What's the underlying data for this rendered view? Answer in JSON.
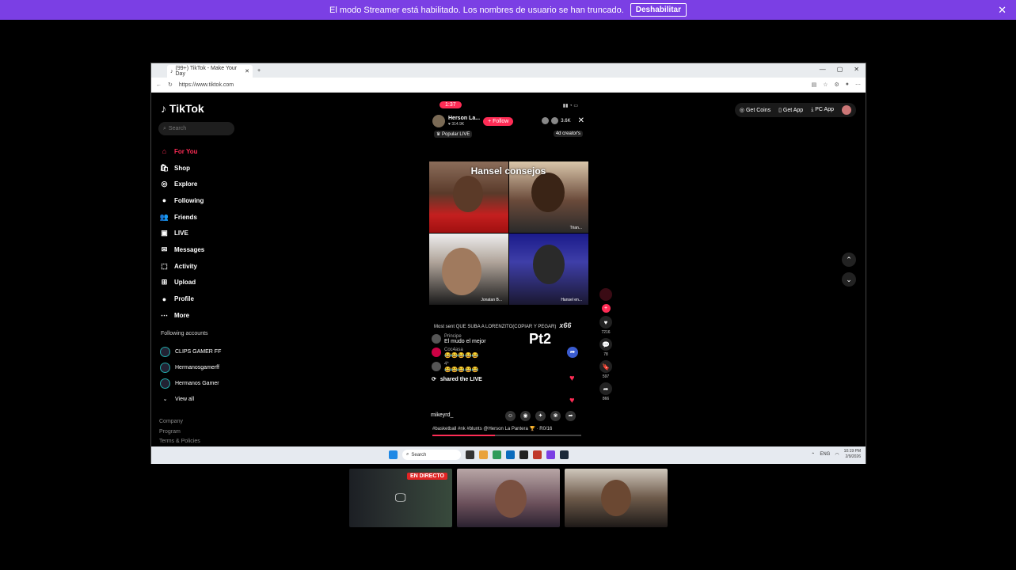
{
  "banner": {
    "text": "El modo Streamer está habilitado. Los nombres de usuario se han truncado.",
    "button": "Deshabilitar",
    "close": "✕"
  },
  "browser": {
    "tab_title": "(99+) TikTok - Make Your Day",
    "new_tab": "+",
    "url": "https://www.tiktok.com",
    "window_controls": [
      "—",
      "▢",
      "✕"
    ]
  },
  "tiktok": {
    "logo": "TikTok",
    "search_placeholder": "Search",
    "nav": [
      {
        "label": "For You",
        "icon": "home-icon",
        "glyph": "⌂"
      },
      {
        "label": "Shop",
        "icon": "shop-icon",
        "glyph": "🛍"
      },
      {
        "label": "Explore",
        "icon": "compass-icon",
        "glyph": "◎"
      },
      {
        "label": "Following",
        "icon": "avatar-icon",
        "glyph": "●"
      },
      {
        "label": "Friends",
        "icon": "friends-icon",
        "glyph": "👥"
      },
      {
        "label": "LIVE",
        "icon": "live-icon",
        "glyph": "▣"
      },
      {
        "label": "Messages",
        "icon": "messages-icon",
        "glyph": "✉"
      },
      {
        "label": "Activity",
        "icon": "activity-icon",
        "glyph": "⬚"
      },
      {
        "label": "Upload",
        "icon": "upload-icon",
        "glyph": "⊞"
      },
      {
        "label": "Profile",
        "icon": "profile-icon",
        "glyph": "●"
      },
      {
        "label": "More",
        "icon": "more-icon",
        "glyph": "⋯"
      }
    ],
    "following_header": "Following accounts",
    "following": [
      "CLIPS GAMER FF",
      "Hermanosgamerff",
      "Hermanos Gamer"
    ],
    "view_all": "View all",
    "footer": [
      "Company",
      "Program",
      "Terms & Policies"
    ],
    "top_right": {
      "coins": "Get Coins",
      "app": "Get App",
      "pc": "PC App"
    }
  },
  "live": {
    "time": "1:37",
    "host_name": "Herson La...",
    "host_likes": "314.9K",
    "follow": "+ Follow",
    "viewers": "3.6K",
    "popular": "Popular LIVE",
    "creators": "4d creator's",
    "grid_title": "Hansel consejos",
    "cell2_name": "Trian...",
    "cell3_name": "Jonatan B...",
    "cell4_name": "Hansel en...",
    "most_sent": "Most sent QUE SUBA A LORENZITO(COPIAR Y PEGAR)",
    "multiplier": "x66",
    "overlay": "Pt2",
    "chat": [
      {
        "user": "Principe",
        "text": "El mudo el mejor"
      },
      {
        "user": "Coc4asa",
        "text": "😂😂😂😂😂"
      },
      {
        "user": "4*",
        "text": "😂😂😂😂😂"
      }
    ],
    "shared": "shared the LIVE",
    "comment_user": "mikeyrd_",
    "hashtags": "#basketball #nk #blunts @Herson La Pantera 🏆 ·   R0/16",
    "progress": 0.42,
    "actions": [
      {
        "icon": "heart-icon",
        "glyph": "♥",
        "count": "7216"
      },
      {
        "icon": "comment-icon",
        "glyph": "💬",
        "count": "78"
      },
      {
        "icon": "bookmark-icon",
        "glyph": "🔖",
        "count": "597"
      },
      {
        "icon": "share-icon",
        "glyph": "➦",
        "count": "866"
      }
    ]
  },
  "taskbar": {
    "search": "Search",
    "lang": "ENG",
    "time": "10:19 PM",
    "date": "2/9/2026"
  }
}
